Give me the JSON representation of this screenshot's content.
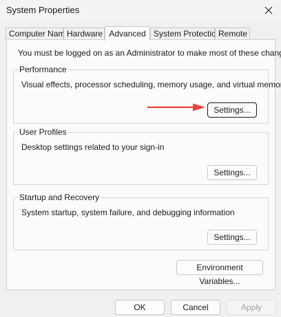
{
  "window": {
    "title": "System Properties"
  },
  "tabs": [
    {
      "label": "Computer Name",
      "active": false
    },
    {
      "label": "Hardware",
      "active": false
    },
    {
      "label": "Advanced",
      "active": true
    },
    {
      "label": "System Protection",
      "active": false
    },
    {
      "label": "Remote",
      "active": false
    }
  ],
  "advanced": {
    "admin_note": "You must be logged on as an Administrator to make most of these changes.",
    "performance": {
      "label": "Performance",
      "description": "Visual effects, processor scheduling, memory usage, and virtual memory",
      "button": "Settings..."
    },
    "user_profiles": {
      "label": "User Profiles",
      "description": "Desktop settings related to your sign-in",
      "button": "Settings..."
    },
    "startup_recovery": {
      "label": "Startup and Recovery",
      "description": "System startup, system failure, and debugging information",
      "button": "Settings..."
    },
    "env_button": "Environment Variables..."
  },
  "footer": {
    "ok": "OK",
    "cancel": "Cancel",
    "apply": "Apply"
  },
  "icons": {
    "close": "close-icon",
    "arrow": "red-arrow-annotation-icon"
  },
  "colors": {
    "arrow": "#e8433a",
    "panel_bg": "#fbfbfb",
    "window_bg": "#f0f0f0"
  }
}
